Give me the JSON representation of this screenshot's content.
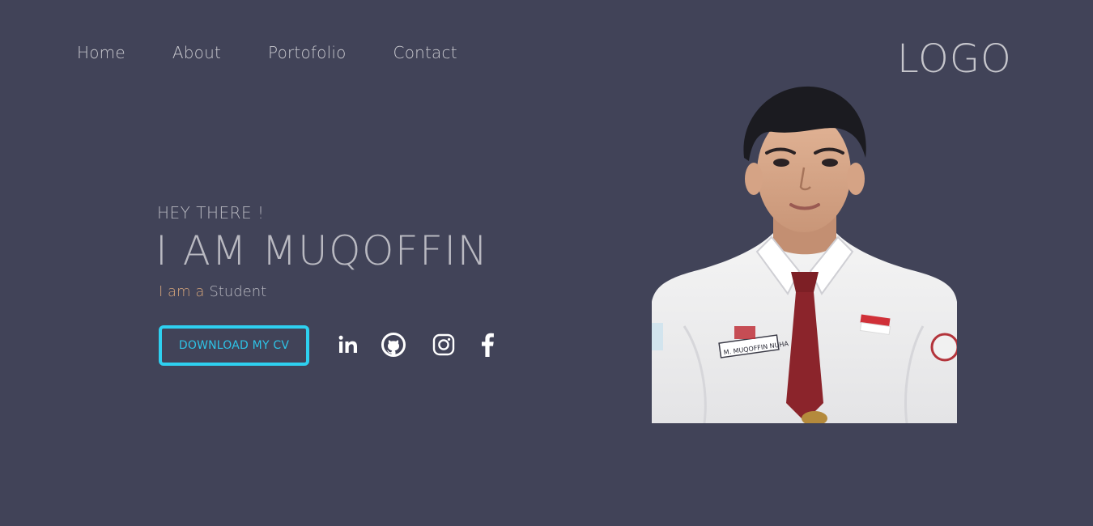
{
  "nav": {
    "items": [
      {
        "label": "Home"
      },
      {
        "label": "About"
      },
      {
        "label": "Portofolio"
      },
      {
        "label": "Contact"
      }
    ]
  },
  "logo": {
    "text": "LOGO"
  },
  "hero": {
    "greeting": "HEY THERE !",
    "name": "I AM MUQOFFIN",
    "role_prefix": "I am a",
    "role": "Student",
    "cv_button": "DOWNLOAD MY CV"
  },
  "socials": [
    {
      "icon": "linkedin-icon"
    },
    {
      "icon": "github-icon"
    },
    {
      "icon": "instagram-icon"
    },
    {
      "icon": "facebook-icon"
    }
  ],
  "photo": {
    "badge_text": "M. MUQOFFIN NUHA"
  },
  "colors": {
    "background": "#414358",
    "accent": "#2ed0f0",
    "role_prefix": "#d1a27a",
    "text": "#b9b9c1"
  }
}
